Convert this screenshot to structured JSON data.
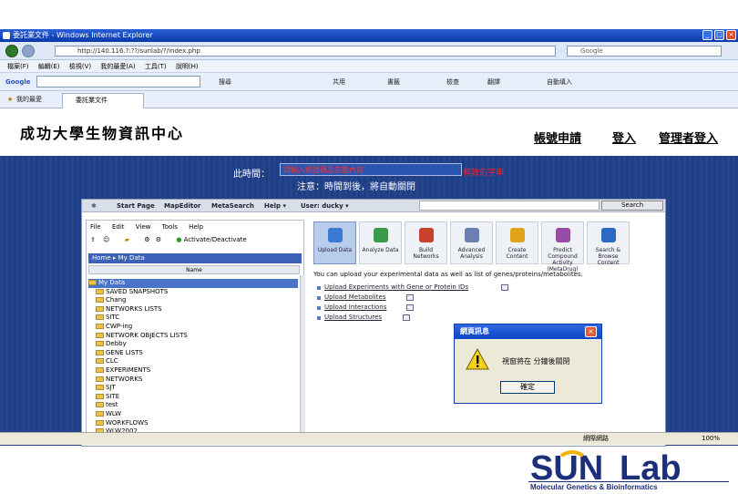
{
  "browser": {
    "window_title": "委託業文件 - Windows Internet Explorer",
    "address": "http://140.116.?:??/sunlab/?/index.php",
    "search_placeholder": "Google",
    "menu": [
      "檔案(F)",
      "編輯(E)",
      "檢視(V)",
      "我的最愛(A)",
      "工具(T)",
      "說明(H)"
    ],
    "google_label": "Google",
    "toolbar_items": [
      "搜尋",
      "共用",
      "書籤",
      "檢查",
      "翻譯",
      "自動填入"
    ],
    "favorites_label": "我的最愛",
    "tab_title": "委託業文件",
    "status_right": "網際網路",
    "zoom": "100%"
  },
  "site": {
    "title": "成功大學生物資訊中心",
    "links": [
      "帳號申請",
      "登入",
      "管理者登入"
    ]
  },
  "notice": {
    "label": "此時間：",
    "box_text": "請輸入驗證碼及完整內容",
    "red_text": "有效的字串",
    "subtitle": "注意：時間到後，將自動關閉"
  },
  "app": {
    "menu": [
      "Start Page",
      "MapEditor",
      "MetaSearch",
      "Help ▾",
      "User: ducky ▾"
    ],
    "search_button": "Search",
    "file_menu": [
      "File",
      "Edit",
      "View",
      "Tools",
      "Help"
    ],
    "activate_label": "Activate/Deactivate",
    "path": [
      "Home",
      "My Data"
    ],
    "column_header": "Name",
    "tree": [
      "My Data",
      "SAVED SNAPSHOTS",
      "Chang",
      "NETWORKS LISTS",
      "SITC",
      "CWP-ing",
      "NETWORK OBJECTS LISTS",
      "Debby",
      "GENE LISTS",
      "CLC",
      "EXPERIMENTS",
      "NETWORKS",
      "SJT",
      "SITE",
      "test",
      "WLW",
      "WORKFLOWS",
      "WLW2002"
    ],
    "tools": [
      "Upload Data",
      "Analyze Data",
      "Build Networks",
      "Advanced Analysis",
      "Create Content",
      "Predict Compound Activity (MetaDrug)",
      "Search & Browse Content"
    ],
    "upload_desc": "You can upload your experimental data as well as list of genes/proteins/metabolites.",
    "upload_links": [
      "Upload Experiments with Gene or Protein IDs",
      "Upload Metabolites",
      "Upload Interactions",
      "Upload Structures"
    ]
  },
  "dialog": {
    "title": "網頁訊息",
    "message": "視窗將在    分鐘後關閉",
    "ok_label": "確定"
  },
  "logo": {
    "brand": "SUNLab",
    "tagline": "Molecular Genetics & Bioinformatics",
    "colors": {
      "navy": "#1d2f7a",
      "yellow": "#f0b400"
    }
  }
}
